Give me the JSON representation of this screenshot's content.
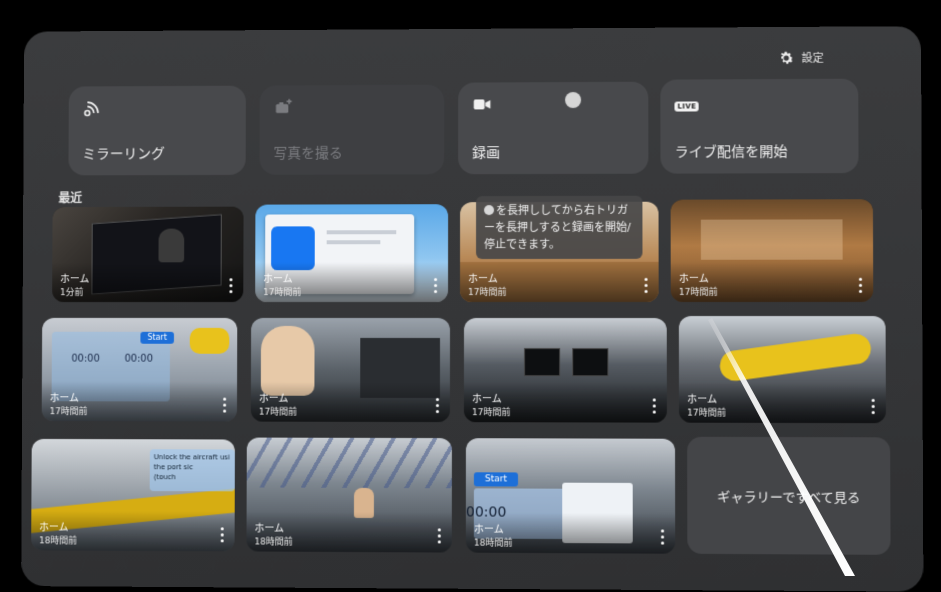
{
  "header": {
    "settings_label": "設定"
  },
  "quick_actions": [
    {
      "label": "ミラーリング",
      "icon": "cast-icon",
      "enabled": true
    },
    {
      "label": "写真を撮る",
      "icon": "camera-add-icon",
      "enabled": false
    },
    {
      "label": "録画",
      "icon": "video-camera-icon",
      "enabled": true
    },
    {
      "label": "ライブ配信を開始",
      "icon": "live-badge-icon",
      "badge": "LIVE",
      "enabled": true
    }
  ],
  "recent": {
    "title": "最近",
    "items": [
      {
        "title": "ホーム",
        "time": "1分前"
      },
      {
        "title": "ホーム",
        "time": "17時間前"
      },
      {
        "title": "ホーム",
        "time": "17時間前"
      },
      {
        "title": "ホーム",
        "time": "17時間前"
      },
      {
        "title": "ホーム",
        "time": "17時間前"
      },
      {
        "title": "ホーム",
        "time": "17時間前"
      },
      {
        "title": "ホーム",
        "time": "17時間前"
      },
      {
        "title": "ホーム",
        "time": "17時間前"
      },
      {
        "title": "ホーム",
        "time": "18時間前"
      },
      {
        "title": "ホーム",
        "time": "18時間前"
      },
      {
        "title": "ホーム",
        "time": "18時間前"
      }
    ],
    "gallery_label": "ギャラリーですべて見る"
  },
  "tooltip": {
    "text": "を長押ししてから右トリガーを長押しすると録画を開始/停止できます。"
  },
  "thumb_texts": {
    "start_label": "Start",
    "timer": "00:00",
    "hint_line1": "Unlock the aircraft usi",
    "hint_line2": "the port sic",
    "hint_line3": "(touch"
  }
}
